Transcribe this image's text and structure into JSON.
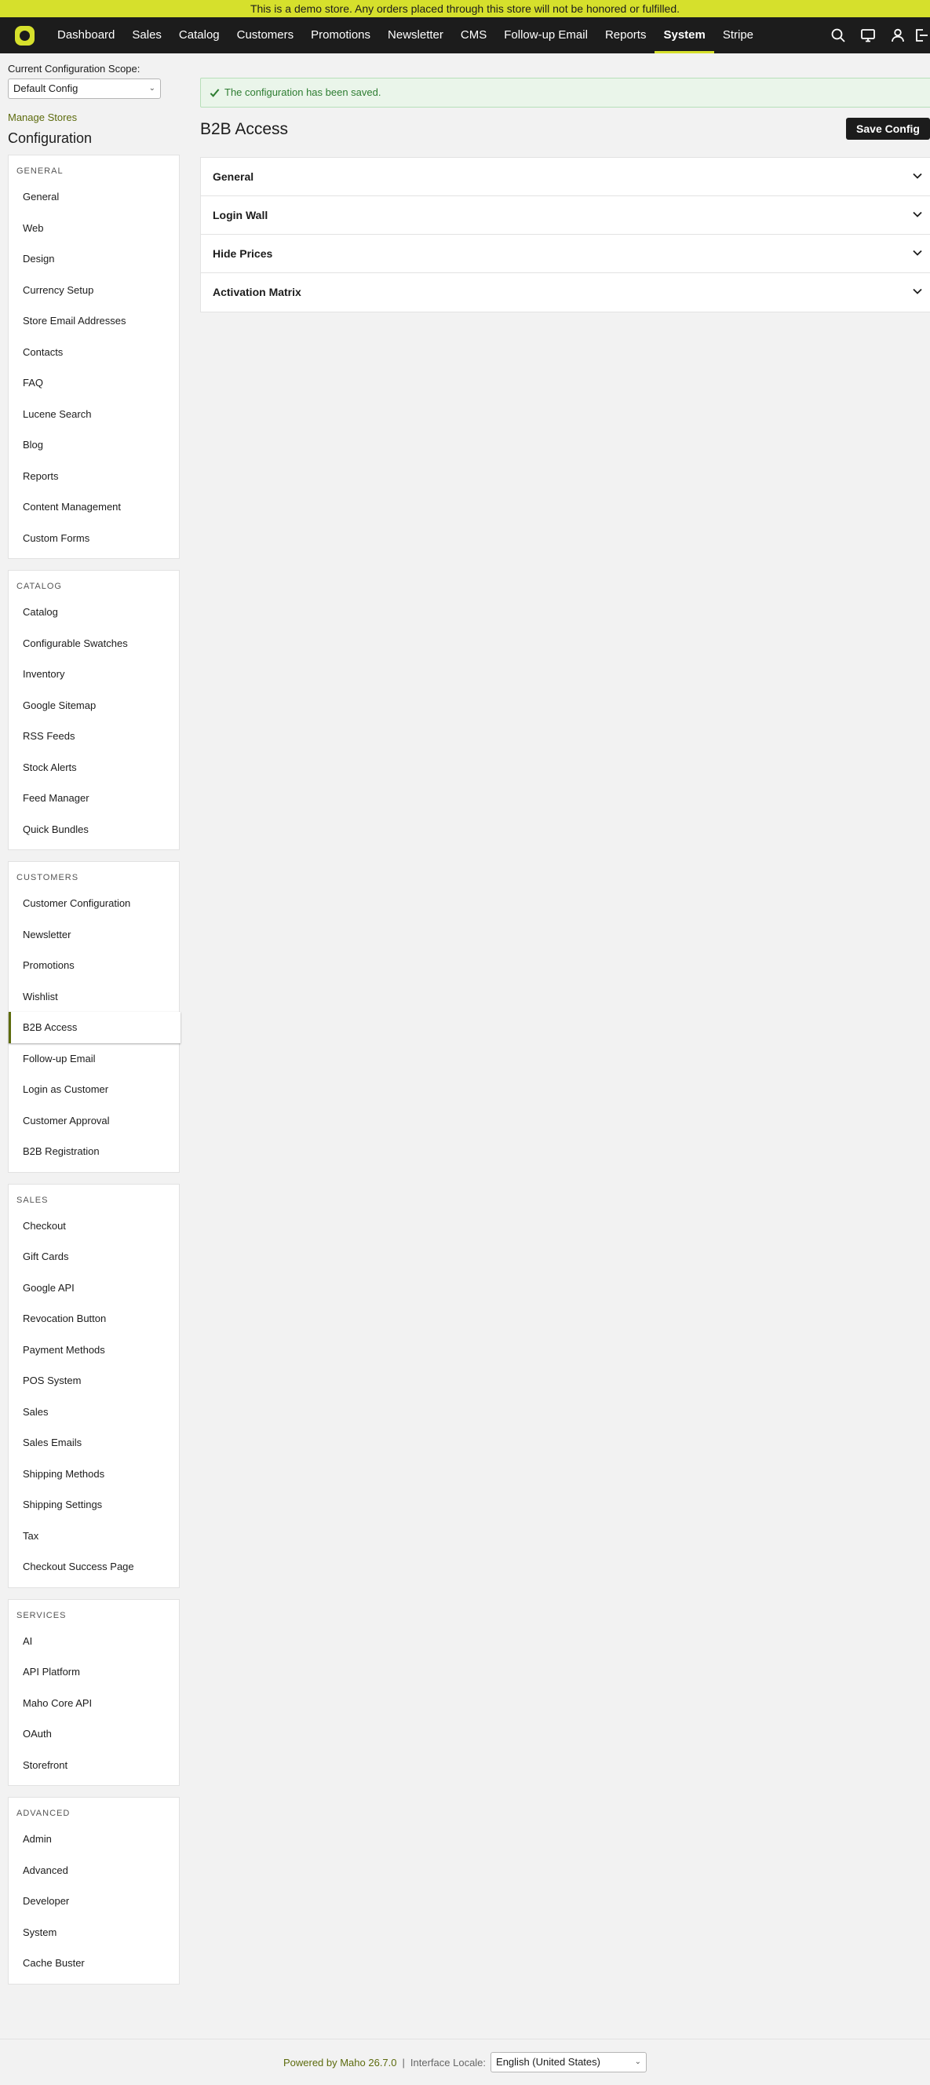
{
  "banner": "This is a demo store. Any orders placed through this store will not be honored or fulfilled.",
  "nav": {
    "items": [
      "Dashboard",
      "Sales",
      "Catalog",
      "Customers",
      "Promotions",
      "Newsletter",
      "CMS",
      "Follow-up Email",
      "Reports",
      "System",
      "Stripe"
    ],
    "active": "System",
    "icons": [
      "search-icon",
      "monitor-icon",
      "user-icon",
      "logout-icon"
    ]
  },
  "sidebar": {
    "scope_label": "Current Configuration Scope:",
    "scope_value": "Default Config",
    "manage_stores": "Manage Stores",
    "title": "Configuration",
    "sections": [
      {
        "heading": "GENERAL",
        "items": [
          "General",
          "Web",
          "Design",
          "Currency Setup",
          "Store Email Addresses",
          "Contacts",
          "FAQ",
          "Lucene Search",
          "Blog",
          "Reports",
          "Content Management",
          "Custom Forms"
        ]
      },
      {
        "heading": "CATALOG",
        "items": [
          "Catalog",
          "Configurable Swatches",
          "Inventory",
          "Google Sitemap",
          "RSS Feeds",
          "Stock Alerts",
          "Feed Manager",
          "Quick Bundles"
        ]
      },
      {
        "heading": "CUSTOMERS",
        "items": [
          "Customer Configuration",
          "Newsletter",
          "Promotions",
          "Wishlist",
          "B2B Access",
          "Follow-up Email",
          "Login as Customer",
          "Customer Approval",
          "B2B Registration"
        ]
      },
      {
        "heading": "SALES",
        "items": [
          "Checkout",
          "Gift Cards",
          "Google API",
          "Revocation Button",
          "Payment Methods",
          "POS System",
          "Sales",
          "Sales Emails",
          "Shipping Methods",
          "Shipping Settings",
          "Tax",
          "Checkout Success Page"
        ]
      },
      {
        "heading": "SERVICES",
        "items": [
          "AI",
          "API Platform",
          "Maho Core API",
          "OAuth",
          "Storefront"
        ]
      },
      {
        "heading": "ADVANCED",
        "items": [
          "Admin",
          "Advanced",
          "Developer",
          "System",
          "Cache Buster"
        ]
      }
    ],
    "active_item": "B2B Access"
  },
  "main": {
    "message": "The configuration has been saved.",
    "title": "B2B Access",
    "save_label": "Save Config",
    "panels": [
      "General",
      "Login Wall",
      "Hide Prices",
      "Activation Matrix"
    ]
  },
  "footer": {
    "powered": "Powered by Maho 26.7.0",
    "separator": "|",
    "locale_label": "Interface Locale:",
    "locale_value": "English (United States)"
  },
  "colors": {
    "accent": "#d6e02c",
    "nav_bg": "#1c1c1c",
    "link": "#5d6b0d",
    "success": "#2e7d32"
  }
}
